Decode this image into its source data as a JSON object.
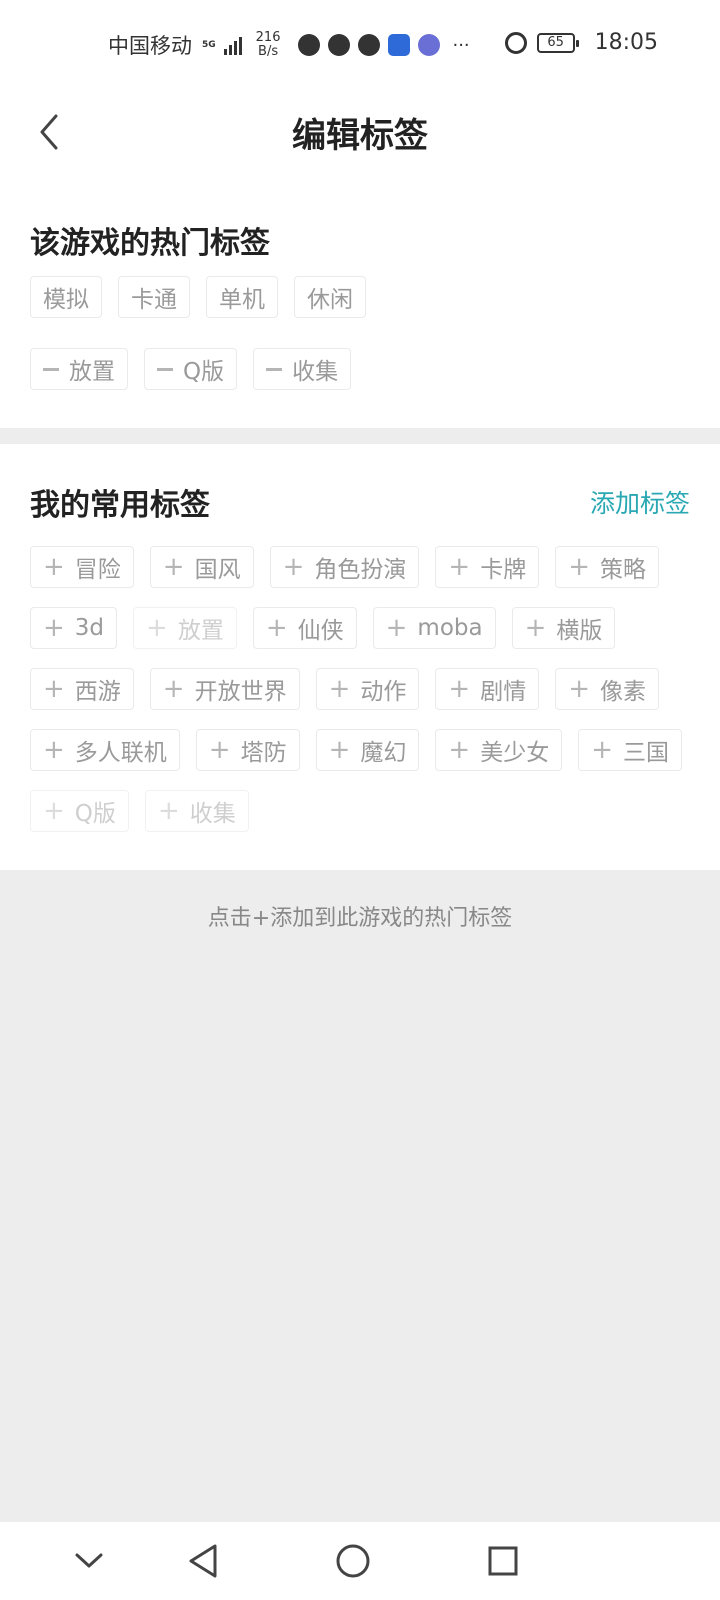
{
  "status_bar": {
    "carrier": "中国移动",
    "network_badge": "5G",
    "net_speed_value": "216",
    "net_speed_unit": "B/s",
    "battery": "65",
    "time": "18:05"
  },
  "header": {
    "title": "编辑标签"
  },
  "hot_tags_section": {
    "title": "该游戏的热门标签",
    "fixed_tags": [
      "模拟",
      "卡通",
      "单机",
      "休闲"
    ],
    "removable_tags": [
      "放置",
      "Q版",
      "收集"
    ]
  },
  "common_tags_section": {
    "title": "我的常用标签",
    "add_link": "添加标签",
    "tags": [
      {
        "label": "冒险",
        "faded": false
      },
      {
        "label": "国风",
        "faded": false
      },
      {
        "label": "角色扮演",
        "faded": false
      },
      {
        "label": "卡牌",
        "faded": false
      },
      {
        "label": "策略",
        "faded": false
      },
      {
        "label": "3d",
        "faded": false
      },
      {
        "label": "放置",
        "faded": true
      },
      {
        "label": "仙侠",
        "faded": false
      },
      {
        "label": "moba",
        "faded": false
      },
      {
        "label": "横版",
        "faded": false
      },
      {
        "label": "西游",
        "faded": false
      },
      {
        "label": "开放世界",
        "faded": false
      },
      {
        "label": "动作",
        "faded": false
      },
      {
        "label": "剧情",
        "faded": false
      },
      {
        "label": "像素",
        "faded": false
      },
      {
        "label": "多人联机",
        "faded": false
      },
      {
        "label": "塔防",
        "faded": false
      },
      {
        "label": "魔幻",
        "faded": false
      },
      {
        "label": "美少女",
        "faded": false
      },
      {
        "label": "三国",
        "faded": false
      },
      {
        "label": "Q版",
        "faded": true
      },
      {
        "label": "收集",
        "faded": true
      }
    ]
  },
  "footer": {
    "hint": "点击+添加到此游戏的热门标签"
  },
  "icons": {
    "back": "chevron-left-icon",
    "nav_down": "chevron-down-icon",
    "nav_back": "triangle-back-icon",
    "nav_home": "circle-home-icon",
    "nav_recent": "square-recent-icon"
  },
  "colors": {
    "accent": "#29a8b3",
    "tag_text": "#9a9a9a",
    "band": "#ededed"
  }
}
